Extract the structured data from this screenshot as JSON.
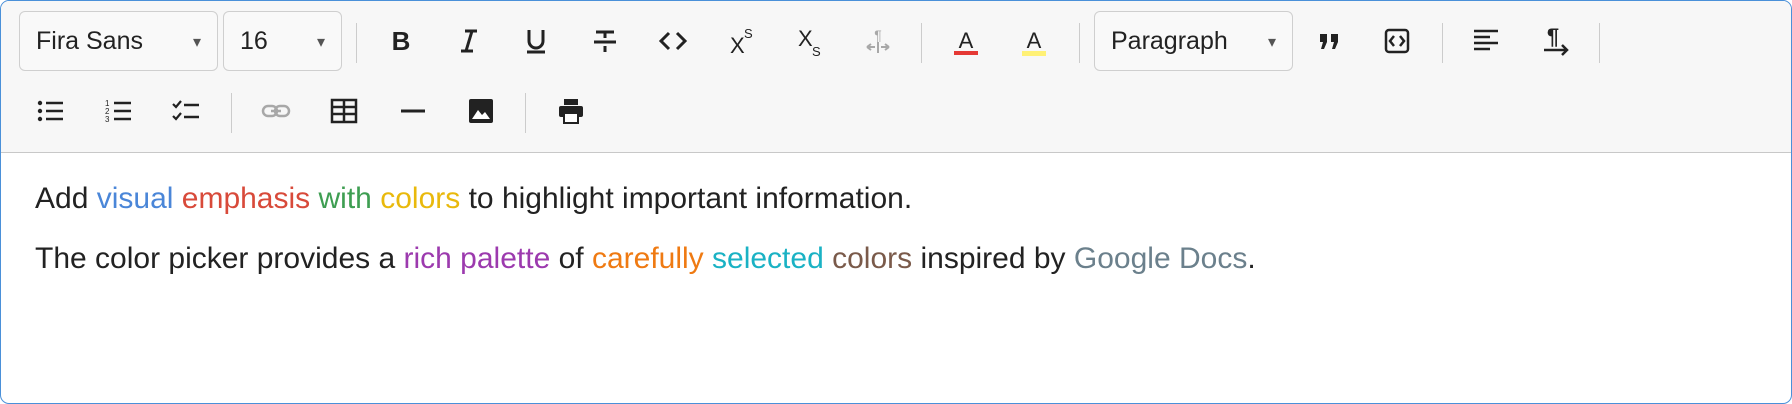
{
  "toolbar": {
    "font_family": {
      "value": "Fira Sans",
      "caret": "▾"
    },
    "font_size": {
      "value": "16",
      "caret": "▾"
    },
    "block_format": {
      "value": "Paragraph",
      "caret": "▾"
    },
    "icons": {
      "bold": "bold-icon",
      "italic": "italic-icon",
      "underline": "underline-icon",
      "strikethrough": "strikethrough-icon",
      "code": "code-icon",
      "superscript": "superscript-icon",
      "subscript": "subscript-icon",
      "text_direction": "text-direction-icon",
      "font_color": "font-color-icon",
      "highlight": "highlight-color-icon",
      "blockquote": "quote-icon",
      "code_block": "code-block-icon",
      "align": "align-left-icon",
      "ltr": "paragraph-ltr-icon",
      "bullet_list": "bullet-list-icon",
      "ordered_list": "ordered-list-icon",
      "task_list": "task-list-icon",
      "link": "link-icon",
      "table": "table-icon",
      "hr": "horizontal-rule-icon",
      "image": "image-icon",
      "print": "print-icon"
    },
    "colors": {
      "font_color_bar": "#e53935",
      "highlight_bar": "#fff176"
    }
  },
  "content": {
    "line1": [
      {
        "text": "Add ",
        "color": "#222222"
      },
      {
        "text": "visual",
        "color": "#4a86d8"
      },
      {
        "text": " ",
        "color": "#222222"
      },
      {
        "text": "emphasis",
        "color": "#d84a3a"
      },
      {
        "text": " ",
        "color": "#222222"
      },
      {
        "text": "with",
        "color": "#3e9e52"
      },
      {
        "text": " ",
        "color": "#222222"
      },
      {
        "text": "colors",
        "color": "#e9b90c"
      },
      {
        "text": " to highlight important information.",
        "color": "#222222"
      }
    ],
    "line2": [
      {
        "text": "The color picker provides a ",
        "color": "#222222"
      },
      {
        "text": "rich palette",
        "color": "#9c3aae"
      },
      {
        "text": " of ",
        "color": "#222222"
      },
      {
        "text": "carefully",
        "color": "#ef7a12"
      },
      {
        "text": " ",
        "color": "#222222"
      },
      {
        "text": "selected",
        "color": "#1ab2c4"
      },
      {
        "text": " ",
        "color": "#222222"
      },
      {
        "text": "colors",
        "color": "#7a5a4a"
      },
      {
        "text": " inspired by ",
        "color": "#222222"
      },
      {
        "text": "Google Docs",
        "color": "#6b808c"
      },
      {
        "text": ".",
        "color": "#222222"
      }
    ]
  }
}
